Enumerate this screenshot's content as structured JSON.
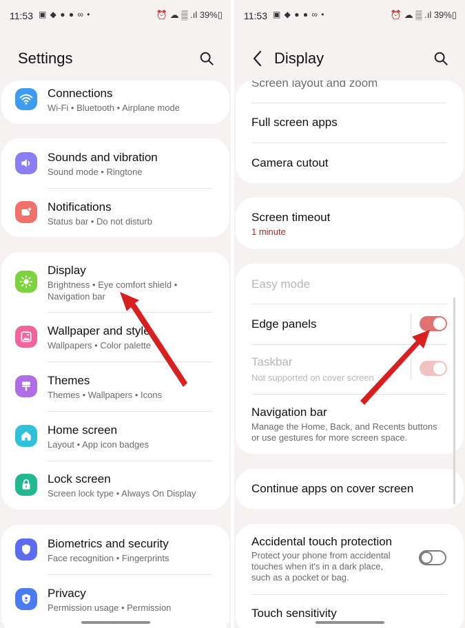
{
  "left": {
    "status": {
      "time": "11:53",
      "icons": "▣ ◆ ● ● ∞ •",
      "right": "⏰ ☁ ▒ .ıl 39%▯"
    },
    "title": "Settings",
    "groups": [
      {
        "items": [
          {
            "label": "Connections",
            "sub": "Wi-Fi  •  Bluetooth  •  Airplane mode",
            "icon": "wifi-icon",
            "color": "#3d9cf0"
          }
        ]
      },
      {
        "items": [
          {
            "label": "Sounds and vibration",
            "sub": "Sound mode  •  Ringtone",
            "icon": "speaker-icon",
            "color": "#8b7ef2"
          },
          {
            "label": "Notifications",
            "sub": "Status bar  •  Do not disturb",
            "icon": "notification-icon",
            "color": "#f2706a"
          }
        ]
      },
      {
        "items": [
          {
            "label": "Display",
            "sub": "Brightness  •  Eye comfort shield  •",
            "sub2": "Navigation bar",
            "icon": "sun-icon",
            "color": "#7cd33e"
          },
          {
            "label": "Wallpaper and style",
            "sub": "Wallpapers  •  Color palette",
            "icon": "image-icon",
            "color": "#f0659c"
          },
          {
            "label": "Themes",
            "sub": "Themes  •  Wallpapers  •  Icons",
            "icon": "brush-icon",
            "color": "#b06ee6"
          },
          {
            "label": "Home screen",
            "sub": "Layout  •  App icon badges",
            "icon": "home-icon",
            "color": "#2ec1d8"
          },
          {
            "label": "Lock screen",
            "sub": "Screen lock type  •  Always On Display",
            "icon": "lock-icon",
            "color": "#22b892"
          }
        ]
      },
      {
        "items": [
          {
            "label": "Biometrics and security",
            "sub": "Face recognition  •  Fingerprints",
            "icon": "shield-icon",
            "color": "#5d6bf0"
          },
          {
            "label": "Privacy",
            "sub": "Permission usage  •  Permission",
            "icon": "privacy-icon",
            "color": "#4b7cef"
          }
        ]
      }
    ]
  },
  "right": {
    "status": {
      "time": "11:53",
      "icons": "▣ ◆ ● ● ∞ •",
      "right": "⏰ ☁ ▒ .ıl 39%▯"
    },
    "title": "Display",
    "rows": {
      "screen_layout": "Screen layout and zoom",
      "full_screen": "Full screen apps",
      "camera_cutout": "Camera cutout",
      "screen_timeout": "Screen timeout",
      "screen_timeout_value": "1 minute",
      "easy_mode": "Easy mode",
      "edge_panels": "Edge panels",
      "taskbar": "Taskbar",
      "taskbar_sub": "Not supported on cover screen",
      "navigation_bar": "Navigation bar",
      "navigation_sub1": "Manage the Home, Back, and Recents buttons",
      "navigation_sub2": "or use gestures for more screen space.",
      "continue_apps": "Continue apps on cover screen",
      "accidental": "Accidental touch protection",
      "accidental_sub1": "Protect your phone from accidental",
      "accidental_sub2": "touches when it's in a dark place,",
      "accidental_sub3": "such as a pocket or bag.",
      "touch_sensitivity": "Touch sensitivity"
    },
    "toggles": {
      "edge_panels": true,
      "taskbar": true,
      "accidental": false
    }
  },
  "colors": {
    "accent": "#e0726f",
    "accent_faded": "#f2c2c0",
    "arrow": "#d7201f",
    "background": "#f6f2f2"
  }
}
